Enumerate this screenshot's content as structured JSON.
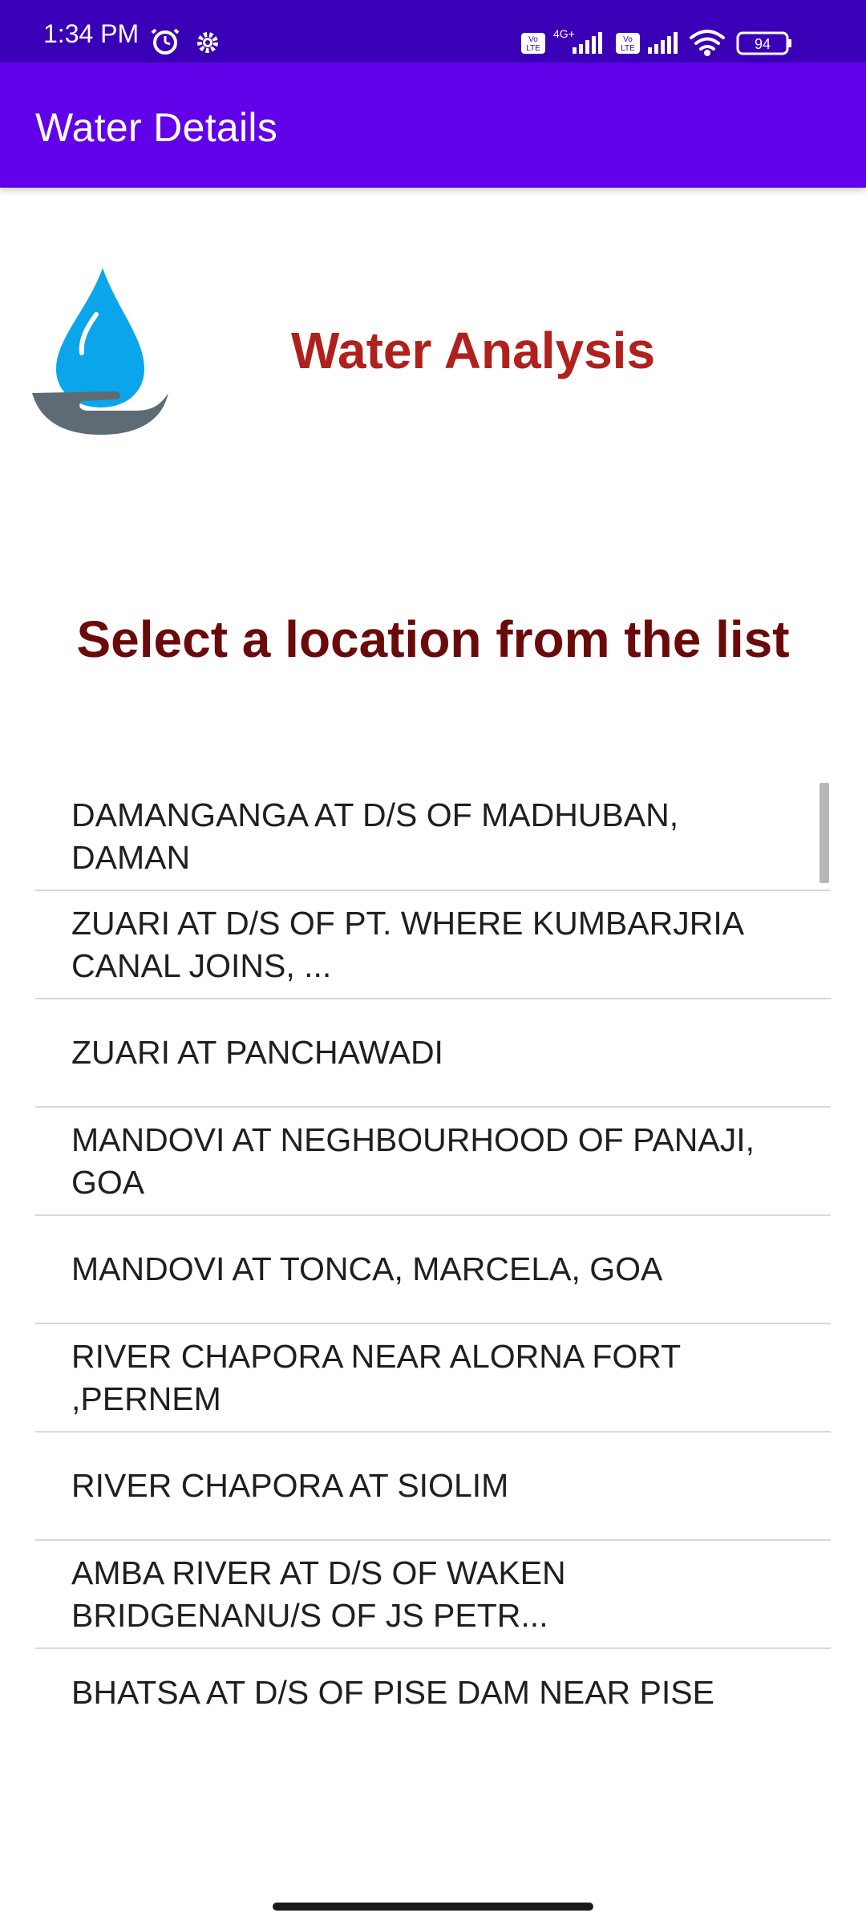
{
  "status": {
    "time": "1:34 PM",
    "network_label": "4G+",
    "battery": "94"
  },
  "appbar": {
    "title": "Water Details"
  },
  "header": {
    "title": "Water Analysis",
    "logo_icon": "water-drop-hand-icon"
  },
  "prompt": "Select a location from the list",
  "locations": [
    "DAMANGANGA AT D/S OF MADHUBAN, DAMAN",
    "ZUARI AT D/S OF PT. WHERE KUMBARJRIA CANAL JOINS, ...",
    "ZUARI AT PANCHAWADI",
    "MANDOVI AT NEGHBOURHOOD OF PANAJI, GOA",
    "MANDOVI AT TONCA, MARCELA, GOA",
    "RIVER CHAPORA NEAR ALORNA FORT ,PERNEM",
    "RIVER CHAPORA AT SIOLIM",
    "AMBA RIVER AT D/S OF WAKEN BRIDGENANU/S OF JS PETR...",
    "BHATSA AT D/S OF PISE DAM NEAR PISE"
  ],
  "colors": {
    "status_bar": "#3a00b8",
    "app_bar": "#6200ea",
    "heading": "#b0201c",
    "subheading": "#6b0a0a",
    "drop": "#0aa5ea",
    "hand": "#5f6b74"
  }
}
